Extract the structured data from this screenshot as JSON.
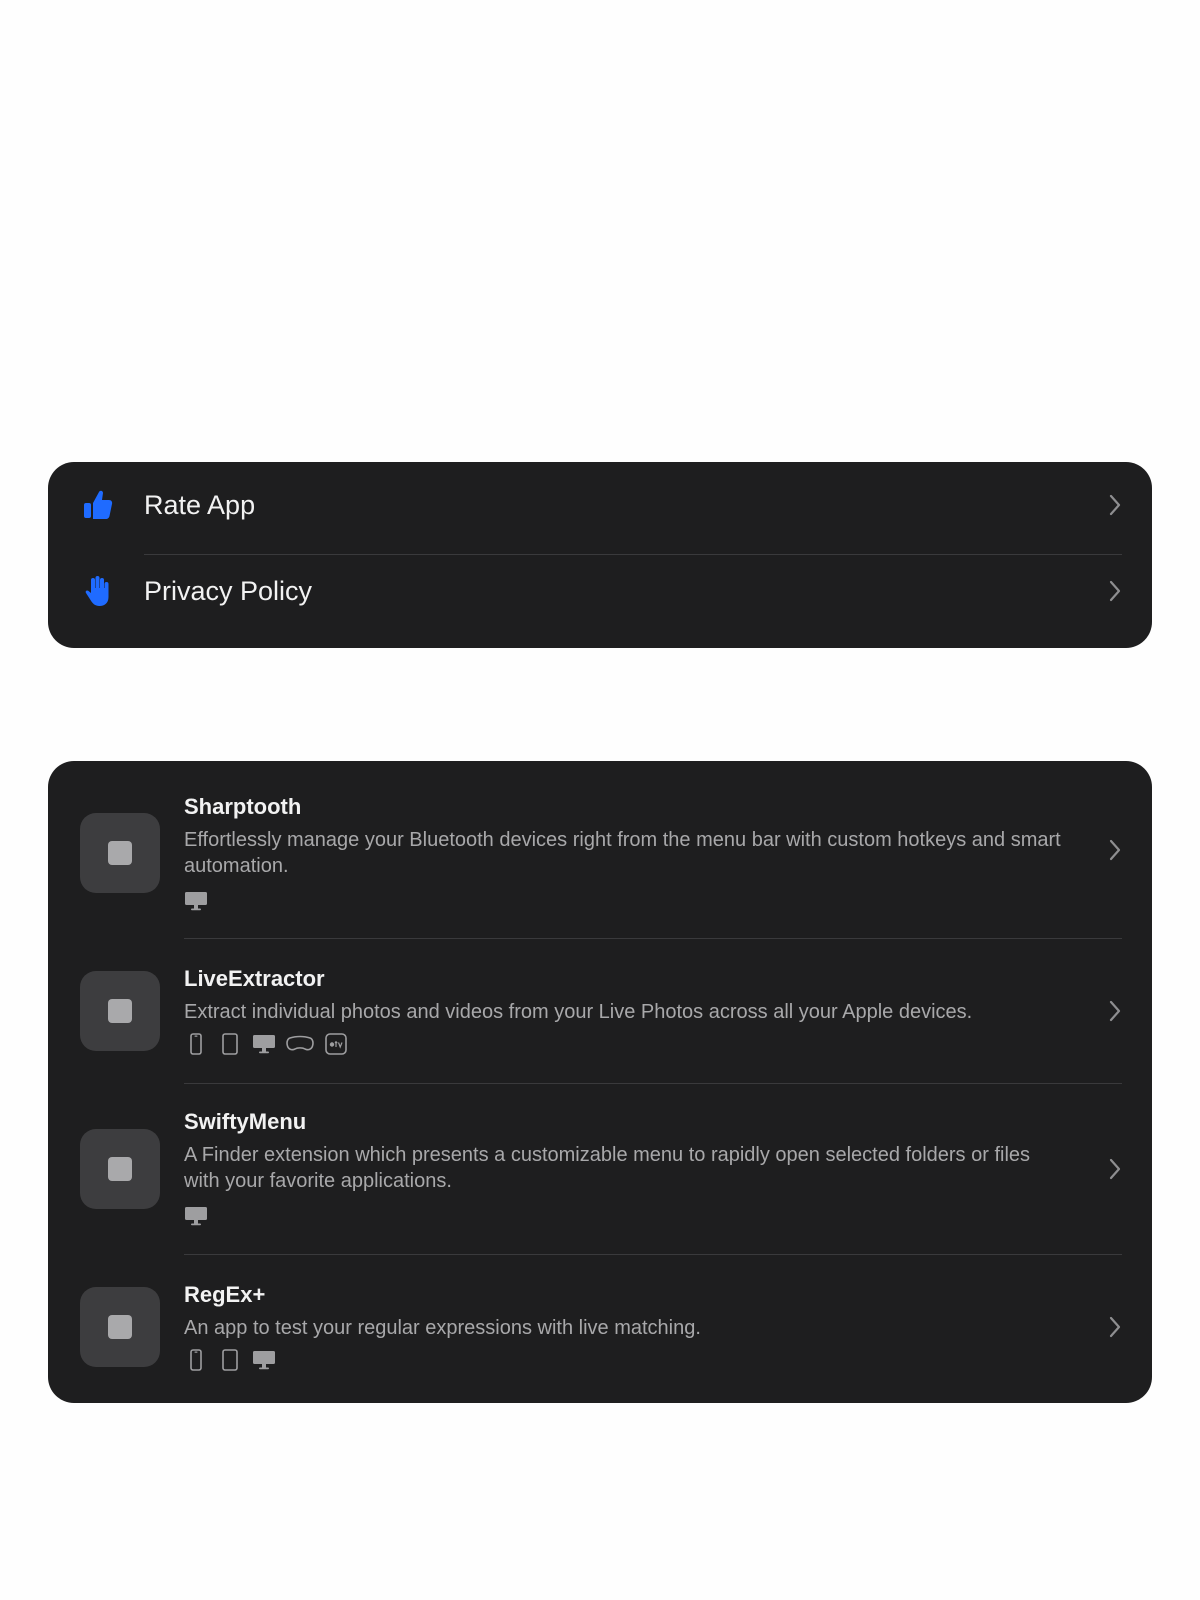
{
  "links": [
    {
      "label": "Rate App",
      "icon": "thumbs-up-icon",
      "icon_color": "#1f6bff"
    },
    {
      "label": "Privacy Policy",
      "icon": "hand-raised-icon",
      "icon_color": "#1f6bff"
    }
  ],
  "apps": [
    {
      "name": "Sharptooth",
      "description": "Effortlessly manage your Bluetooth devices right from the menu bar with custom hotkeys and smart automation.",
      "platforms": [
        "mac"
      ]
    },
    {
      "name": "LiveExtractor",
      "description": "Extract individual photos and videos from your Live Photos across all your Apple devices.",
      "platforms": [
        "iphone",
        "ipad",
        "mac",
        "vision",
        "tv"
      ]
    },
    {
      "name": "SwiftyMenu",
      "description": "A Finder extension which presents a customizable menu to rapidly open selected folders or files with your favorite applications.",
      "platforms": [
        "mac"
      ]
    },
    {
      "name": "RegEx+",
      "description": "An app to test your regular expressions with live matching.",
      "platforms": [
        "iphone",
        "ipad",
        "mac"
      ]
    }
  ],
  "colors": {
    "page_background": "#fefefe",
    "card_background": "#1e1e1f",
    "accent": "#1f6bff",
    "secondary_text": "#a8a8aa"
  }
}
